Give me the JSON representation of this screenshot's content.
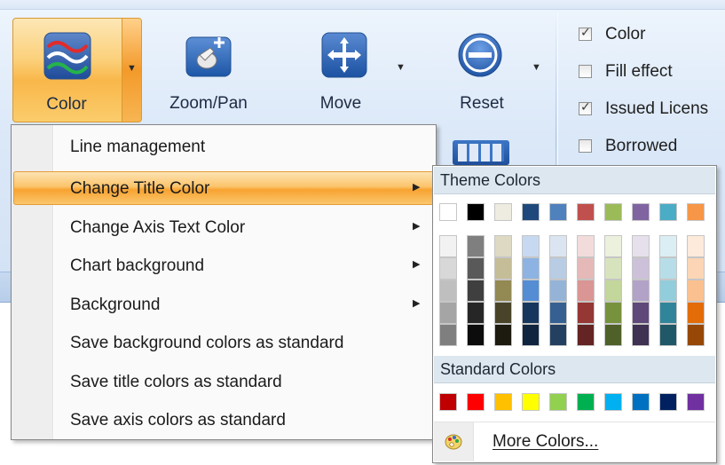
{
  "toolbar": {
    "buttons": [
      {
        "id": "color",
        "label": "Color",
        "icon": "wave-lines-icon",
        "has_dropdown": true
      },
      {
        "id": "zoom",
        "label": "Zoom/Pan",
        "icon": "hand-zoom-icon",
        "has_dropdown": false
      },
      {
        "id": "move",
        "label": "Move",
        "icon": "move-arrows-icon",
        "has_dropdown": true
      },
      {
        "id": "reset",
        "label": "Reset",
        "icon": "reset-circle-icon",
        "has_dropdown": true
      }
    ],
    "arrow_glyph": "▼"
  },
  "options": {
    "checkboxes": [
      {
        "label": "Color",
        "checked": true
      },
      {
        "label": "Fill effect",
        "checked": false
      },
      {
        "label": "Issued Licens",
        "checked": true
      },
      {
        "label": "Borrowed",
        "checked": false
      }
    ],
    "tick_glyph": "✓"
  },
  "menu": {
    "items": [
      {
        "label": "Line management",
        "submenu": false,
        "active": false
      },
      {
        "label": "Change Title Color",
        "submenu": true,
        "active": true
      },
      {
        "label": "Change Axis Text Color",
        "submenu": true,
        "active": false
      },
      {
        "label": "Chart background",
        "submenu": true,
        "active": false
      },
      {
        "label": "Background",
        "submenu": true,
        "active": false
      },
      {
        "label": "Save background colors as standard",
        "submenu": false,
        "active": false
      },
      {
        "label": "Save title colors as standard",
        "submenu": false,
        "active": false
      },
      {
        "label": "Save axis colors as standard",
        "submenu": false,
        "active": false
      }
    ],
    "submenu_glyph": "▶"
  },
  "picker": {
    "theme_header": "Theme Colors",
    "standard_header": "Standard Colors",
    "more_colors": "More Colors...",
    "theme_colors": [
      "#ffffff",
      "#000000",
      "#eeece1",
      "#1f497d",
      "#4f81bd",
      "#c0504d",
      "#9bbb59",
      "#8064a2",
      "#4bacc6",
      "#f79646"
    ],
    "theme_shades": [
      [
        "#f2f2f2",
        "#d8d8d8",
        "#bfbfbf",
        "#a5a5a5",
        "#7f7f7f"
      ],
      [
        "#7f7f7f",
        "#595959",
        "#3f3f3f",
        "#262626",
        "#0c0c0c"
      ],
      [
        "#ddd9c3",
        "#c4bd97",
        "#938953",
        "#494429",
        "#1d1b10"
      ],
      [
        "#c6d9f0",
        "#8db3e2",
        "#548dd4",
        "#17365d",
        "#0f243e"
      ],
      [
        "#dbe5f1",
        "#b8cce4",
        "#95b3d7",
        "#366092",
        "#244061"
      ],
      [
        "#f2dcdb",
        "#e5b9b7",
        "#d99694",
        "#953734",
        "#632423"
      ],
      [
        "#ebf1dd",
        "#d7e3bc",
        "#c3d69b",
        "#76923c",
        "#4f6128"
      ],
      [
        "#e5e0ec",
        "#ccc1d9",
        "#b2a2c7",
        "#5f497a",
        "#3f3151"
      ],
      [
        "#dbeef3",
        "#b7dde8",
        "#92cddc",
        "#31859b",
        "#205867"
      ],
      [
        "#fdeada",
        "#fbd5b5",
        "#fac08f",
        "#e36c09",
        "#974806"
      ]
    ],
    "standard_colors": [
      "#c00000",
      "#ff0000",
      "#ffc000",
      "#ffff00",
      "#92d050",
      "#00b050",
      "#00b0f0",
      "#0070c0",
      "#002060",
      "#7030a0"
    ]
  }
}
